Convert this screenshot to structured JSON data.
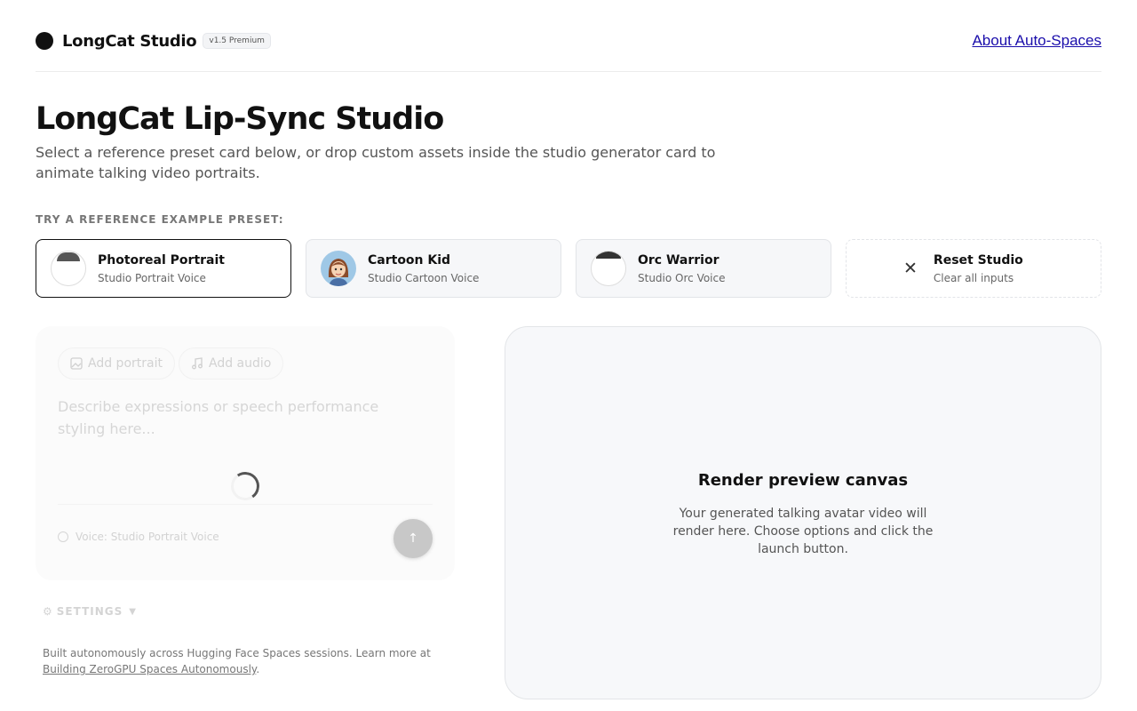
{
  "header": {
    "brand": "LongCat Studio",
    "version_badge": "v1.5 Premium",
    "about_link": "About Auto-Spaces"
  },
  "hero": {
    "title": "LongCat Lip-Sync Studio",
    "subtitle": "Select a reference preset card below, or drop custom assets inside the studio generator card to animate talking video portraits."
  },
  "presets": {
    "label": "TRY A REFERENCE EXAMPLE PRESET:",
    "items": [
      {
        "name": "Photoreal Portrait",
        "desc": "Studio Portrait Voice",
        "icon": "photoreal-avatar-icon",
        "active": true
      },
      {
        "name": "Cartoon Kid",
        "desc": "Studio Cartoon Voice",
        "icon": "cartoon-avatar-icon"
      },
      {
        "name": "Orc Warrior",
        "desc": "Studio Orc Voice",
        "icon": "orc-avatar-icon"
      },
      {
        "name": "Reset Studio",
        "desc": "Clear all inputs",
        "icon": "close-icon"
      }
    ]
  },
  "generator": {
    "add_portrait": "Add portrait",
    "add_audio": "Add audio",
    "prompt_placeholder": "Describe expressions or speech performance styling here...",
    "voice": "Voice: Studio Portrait Voice",
    "send_icon": "arrow-up-icon",
    "loading": true
  },
  "settings": {
    "label": "SETTINGS"
  },
  "footer": {
    "text": "Built autonomously across Hugging Face Spaces sessions. Learn more at ",
    "link": "Building ZeroGPU Spaces Autonomously",
    "end": "."
  },
  "preview": {
    "title": "Render preview canvas",
    "text": "Your generated talking avatar video will render here. Choose options and click the launch button."
  },
  "colors": {
    "accent": "#111111",
    "link": "#1a0dab",
    "preview_bg": "#f7f8fa"
  }
}
